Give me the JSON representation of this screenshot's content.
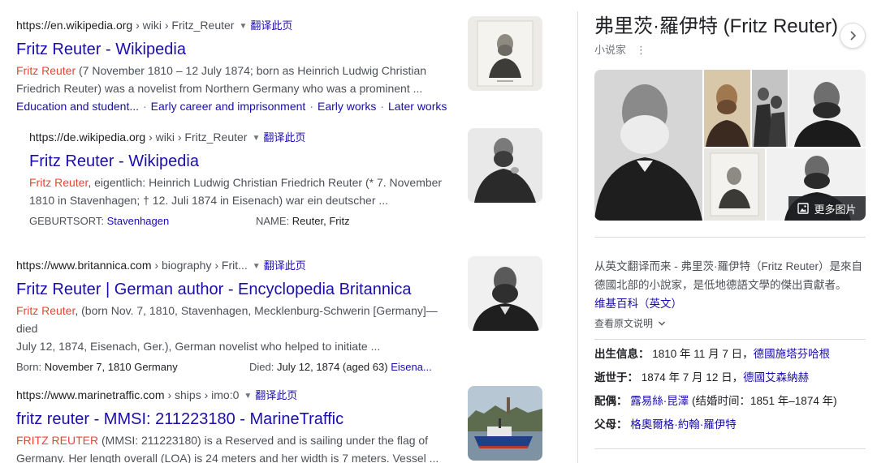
{
  "results": [
    {
      "url": "https://en.wikipedia.org",
      "breadcrumb": " › wiki › Fritz_Reuter",
      "translate": "翻译此页",
      "title": "Fritz Reuter - Wikipedia",
      "snippet_hl": "Fritz Reuter",
      "snippet_l1": " (7 November 1810 – 12 July 1874; born as Heinrich Ludwig Christian",
      "snippet_l2": "Friedrich Reuter) was a novelist from Northern Germany who was a prominent ...",
      "sitelinks": [
        "Education and student...",
        "Early career and imprisonment",
        "Early works",
        "Later works"
      ]
    },
    {
      "url": "https://de.wikipedia.org",
      "breadcrumb": " › wiki › Fritz_Reuter",
      "translate": "翻译此页",
      "title": "Fritz Reuter - Wikipedia",
      "snippet_hl": "Fritz Reuter",
      "snippet_l1": ", eigentlich: Heinrich Ludwig Christian Friedrich Reuter (* 7. November",
      "snippet_l2": "1810 in Stavenhagen; † 12. Juli 1874 in Eisenach) war ein deutscher ...",
      "fact1_label": "GEBURTSORT: ",
      "fact1_value": "Stavenhagen",
      "fact2_label": "NAME: ",
      "fact2_value": "Reuter, Fritz"
    },
    {
      "url": "https://www.britannica.com",
      "breadcrumb": " › biography › Frit...",
      "translate": "翻译此页",
      "title": "Fritz Reuter | German author - Encyclopedia Britannica",
      "snippet_hl": "Fritz Reuter",
      "snippet_l1": ", (born Nov. 7, 1810, Stavenhagen, Mecklenburg-Schwerin [Germany]—died",
      "snippet_l2": "July 12, 1874, Eisenach, Ger.), German novelist who helped to initiate ...",
      "fact1_label": "Born: ",
      "fact1_value": "November 7, 1810 Germany",
      "fact2_label": "Died: ",
      "fact2_value": "July 12, 1874 (aged 63) ",
      "fact2_link": "Eisena..."
    },
    {
      "url": "https://www.marinetraffic.com",
      "breadcrumb": " › ships › imo:0",
      "translate": "翻译此页",
      "title": "fritz reuter - MMSI: 211223180 - MarineTraffic",
      "snippet_hl": "FRITZ REUTER",
      "snippet_l1": " (MMSI: 211223180) is a Reserved and is sailing under the flag of",
      "snippet_l2": "Germany. Her length overall (LOA) is 24 meters and her width is 7 meters. Vessel ..."
    }
  ],
  "kp": {
    "title": "弗里茨·羅伊特 (Fritz Reuter)",
    "subtitle": "小说家",
    "more_images": "更多图片",
    "desc": "从英文翻译而来 - 弗里茨·羅伊特（Fritz Reuter）是來自德國北部的小說家，是低地德語文學的傑出貢獻者。",
    "desc_source": "维基百科（英文）",
    "view_original": "查看原文说明",
    "born_label": "出生信息：",
    "born_value": "1810 年 11 月 7 日，",
    "born_place": "德國施塔芬哈根",
    "died_label": "逝世于：",
    "died_value": "1874 年 7 月 12 日，",
    "died_place": "德國艾森納赫",
    "spouse_label": "配偶：",
    "spouse_name": "露易絲·昆澤",
    "spouse_detail": " (结婚时间：1851 年–1874 年)",
    "parents_label": "父母：",
    "parent1": "格奧爾格·約翰·羅伊特"
  },
  "icons": [
    "chevron-right-icon",
    "dropdown-triangle-icon",
    "more-vert-icon",
    "image-icon",
    "chevron-down-icon"
  ]
}
